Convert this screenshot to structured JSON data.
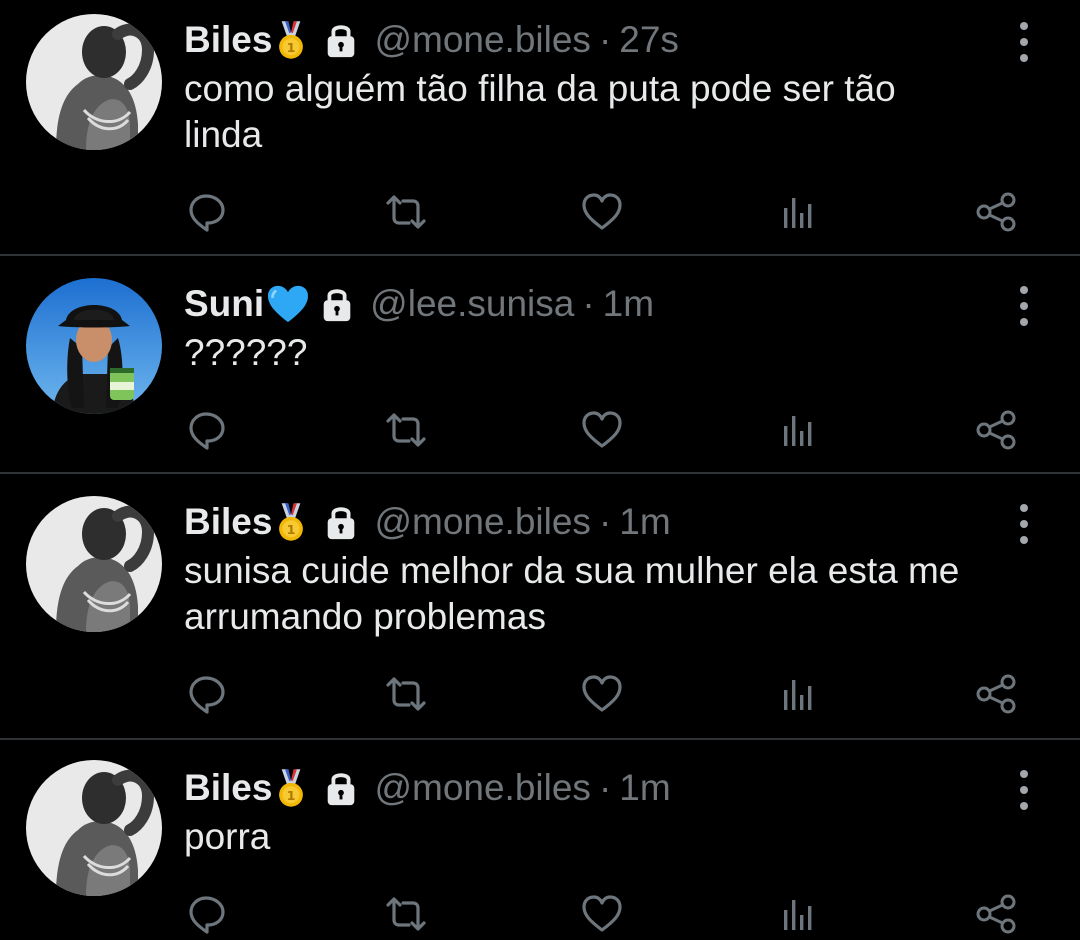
{
  "tweets": [
    {
      "name": "Biles",
      "name_emoji": "gold-medal",
      "locked": true,
      "handle": "@mone.biles",
      "sep": "·",
      "time": "27s",
      "text": "como alguém tão filha da puta pode ser tão\nlinda",
      "avatar": "grayscale-back-photo"
    },
    {
      "name": "Suni",
      "name_emoji": "blue-heart",
      "locked": true,
      "handle": "@lee.sunisa",
      "sep": "·",
      "time": "1m",
      "text": "??????",
      "avatar": "color-photo-bucket-hat"
    },
    {
      "name": "Biles",
      "name_emoji": "gold-medal",
      "locked": true,
      "handle": "@mone.biles",
      "sep": "·",
      "time": "1m",
      "text": "sunisa cuide melhor da sua mulher ela esta me\narrumando problemas",
      "avatar": "grayscale-back-photo"
    },
    {
      "name": "Biles",
      "name_emoji": "gold-medal",
      "locked": true,
      "handle": "@mone.biles",
      "sep": "·",
      "time": "1m",
      "text": "porra",
      "avatar": "grayscale-back-photo"
    }
  ],
  "action_icons": [
    "reply-icon",
    "retweet-icon",
    "like-icon",
    "views-icon",
    "share-icon"
  ],
  "colors": {
    "background": "#000000",
    "text": "#e7e9ea",
    "secondary": "#71767b",
    "icon": "#6e767d",
    "divider": "#2f3336",
    "medal_gold": "#f2b705",
    "heart_blue": "#2ea8f5"
  }
}
